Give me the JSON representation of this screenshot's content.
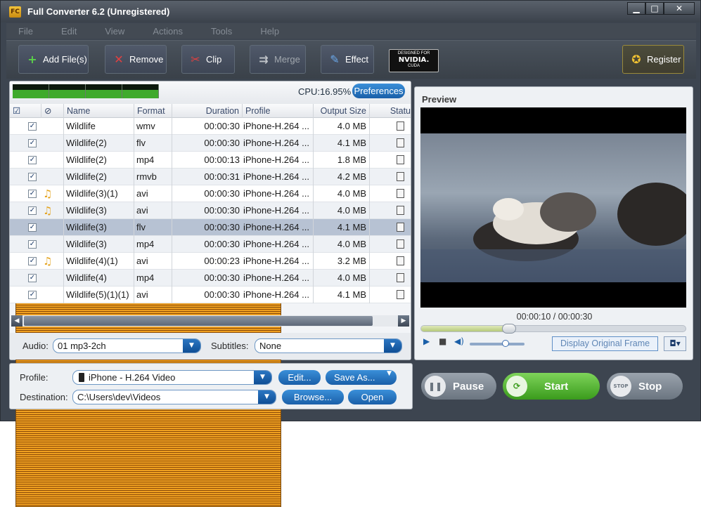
{
  "window": {
    "title": "Full Converter 6.2 (Unregistered)",
    "app_icon_label": "FC",
    "buttons": [
      "▁",
      "□",
      "✕"
    ]
  },
  "menu": [
    "File",
    "Edit",
    "View",
    "Actions",
    "Tools",
    "Help"
  ],
  "toolbar": {
    "add_files": "Add File(s)",
    "remove": "Remove",
    "clip": "Clip",
    "merge": "Merge",
    "effect": "Effect",
    "nvidia": {
      "line1": "DESIGNED FOR",
      "line2": "NVIDIA.",
      "line3": "CUDA"
    },
    "register": "Register"
  },
  "cpu": {
    "label": "CPU:16.95%",
    "preferences": "Preferences"
  },
  "columns": {
    "check": "☑",
    "type": "⊘",
    "name": "Name",
    "format": "Format",
    "duration": "Duration",
    "profile": "Profile",
    "output_size": "Output Size",
    "status": "Statu"
  },
  "files": [
    {
      "name": "Wildlife",
      "format": "wmv",
      "duration": "00:00:30",
      "profile": "iPhone-H.264 ...",
      "size": "4.0 MB",
      "type": "video"
    },
    {
      "name": "Wildlife(2)",
      "format": "flv",
      "duration": "00:00:30",
      "profile": "iPhone-H.264 ...",
      "size": "4.1 MB",
      "type": "video"
    },
    {
      "name": "Wildlife(2)",
      "format": "mp4",
      "duration": "00:00:13",
      "profile": "iPhone-H.264 ...",
      "size": "1.8 MB",
      "type": "video"
    },
    {
      "name": "Wildlife(2)",
      "format": "rmvb",
      "duration": "00:00:31",
      "profile": "iPhone-H.264 ...",
      "size": "4.2 MB",
      "type": "video"
    },
    {
      "name": "Wildlife(3)(1)",
      "format": "avi",
      "duration": "00:00:30",
      "profile": "iPhone-H.264 ...",
      "size": "4.0 MB",
      "type": "audio"
    },
    {
      "name": "Wildlife(3)",
      "format": "avi",
      "duration": "00:00:30",
      "profile": "iPhone-H.264 ...",
      "size": "4.0 MB",
      "type": "audio"
    },
    {
      "name": "Wildlife(3)",
      "format": "flv",
      "duration": "00:00:30",
      "profile": "iPhone-H.264 ...",
      "size": "4.1 MB",
      "type": "video",
      "selected": true
    },
    {
      "name": "Wildlife(3)",
      "format": "mp4",
      "duration": "00:00:30",
      "profile": "iPhone-H.264 ...",
      "size": "4.0 MB",
      "type": "video"
    },
    {
      "name": "Wildlife(4)(1)",
      "format": "avi",
      "duration": "00:00:23",
      "profile": "iPhone-H.264 ...",
      "size": "3.2 MB",
      "type": "audio"
    },
    {
      "name": "Wildlife(4)",
      "format": "mp4",
      "duration": "00:00:30",
      "profile": "iPhone-H.264 ...",
      "size": "4.0 MB",
      "type": "video"
    },
    {
      "name": "Wildlife(5)(1)(1)",
      "format": "avi",
      "duration": "00:00:30",
      "profile": "iPhone-H.264 ...",
      "size": "4.1 MB",
      "type": "video"
    }
  ],
  "audio": {
    "label": "Audio:",
    "value": "01 mp3-2ch"
  },
  "subtitles": {
    "label": "Subtitles:",
    "value": "None"
  },
  "preview": {
    "title": "Preview",
    "time": "00:00:10 / 00:00:30",
    "progress": 0.33,
    "volume": 0.65,
    "display_original_frame": "Display Original Frame"
  },
  "profile": {
    "label": "Profile:",
    "value": "iPhone - H.264 Video",
    "edit": "Edit...",
    "save_as": "Save As..."
  },
  "destination": {
    "label": "Destination:",
    "value": "C:\\Users\\dev\\Videos",
    "browse": "Browse...",
    "open": "Open"
  },
  "actions": {
    "pause": "Pause",
    "start": "Start",
    "stop": "Stop"
  },
  "colors": {
    "start": "#4db32b",
    "accent": "#1a5fa8",
    "chrome": "#3d4550"
  }
}
